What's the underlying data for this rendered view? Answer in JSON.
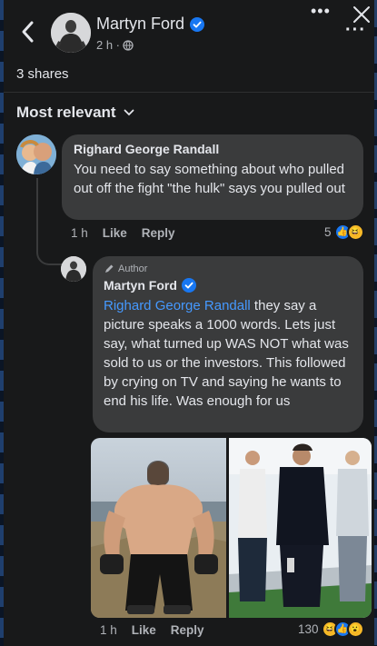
{
  "header": {
    "name": "Martyn Ford",
    "time": "2 h ·",
    "verified_color": "#1877f2",
    "back_icon": "chevron-left-icon",
    "privacy_icon": "globe-icon",
    "more_icon": "more-horizontal-icon",
    "close_icon": "close-icon"
  },
  "post": {
    "shares": "3 shares",
    "sort_label": "Most relevant"
  },
  "comment": {
    "author": "Righard George Randall",
    "text": "You need to say something about who pulled out off the fight \"the hulk\" says you pulled out",
    "time": "1 h",
    "like": "Like",
    "reply": "Reply",
    "reaction_count": "5"
  },
  "reply": {
    "badge": "Author",
    "author": "Martyn Ford",
    "mention": "Righard George Randall",
    "text": " they say a picture speaks a 1000 words.  Lets just say, what turned up WAS NOT what was sold to us or the investors.  This followed by crying on TV and saying he wants to end his life.  Was enough for us",
    "time": "1 h",
    "like": "Like",
    "reply": "Reply",
    "reaction_count": "130"
  },
  "colors": {
    "background": "#18191a",
    "bubble": "#3a3b3c",
    "mention": "#4599ff",
    "text": "#e4e6eb",
    "muted": "#b0b3b8"
  }
}
